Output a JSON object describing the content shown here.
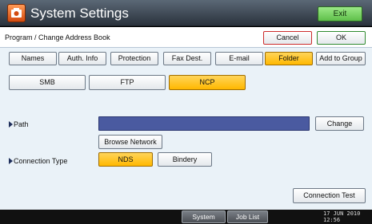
{
  "window": {
    "title": "System Settings",
    "exit_label": "Exit"
  },
  "header": {
    "breadcrumb": "Program / Change Address Book",
    "cancel_label": "Cancel",
    "ok_label": "OK"
  },
  "tabs": [
    {
      "label": "Names",
      "selected": false
    },
    {
      "label": "Auth. Info",
      "selected": false
    },
    {
      "label": "Protection",
      "selected": false
    },
    {
      "label": "Fax Dest.",
      "selected": false
    },
    {
      "label": "E-mail",
      "selected": false
    },
    {
      "label": "Folder",
      "selected": true
    },
    {
      "label": "Add to Group",
      "selected": false
    }
  ],
  "protocols": [
    {
      "label": "SMB",
      "selected": false
    },
    {
      "label": "FTP",
      "selected": false
    },
    {
      "label": "NCP",
      "selected": true
    }
  ],
  "path": {
    "label": "Path",
    "value": "",
    "change_label": "Change",
    "browse_label": "Browse Network"
  },
  "connection_type": {
    "label": "Connection Type",
    "options": [
      {
        "label": "NDS",
        "selected": true
      },
      {
        "label": "Bindery",
        "selected": false
      }
    ]
  },
  "connection_test_label": "Connection Test",
  "statusbar": {
    "system_status_label": "System Status",
    "job_list_label": "Job List",
    "date": "17 JUN 2010",
    "time": "12:56"
  },
  "colors": {
    "selected": "#ffb800",
    "path_bar": "#4a5aa0",
    "exit": "#5fbf4a"
  }
}
